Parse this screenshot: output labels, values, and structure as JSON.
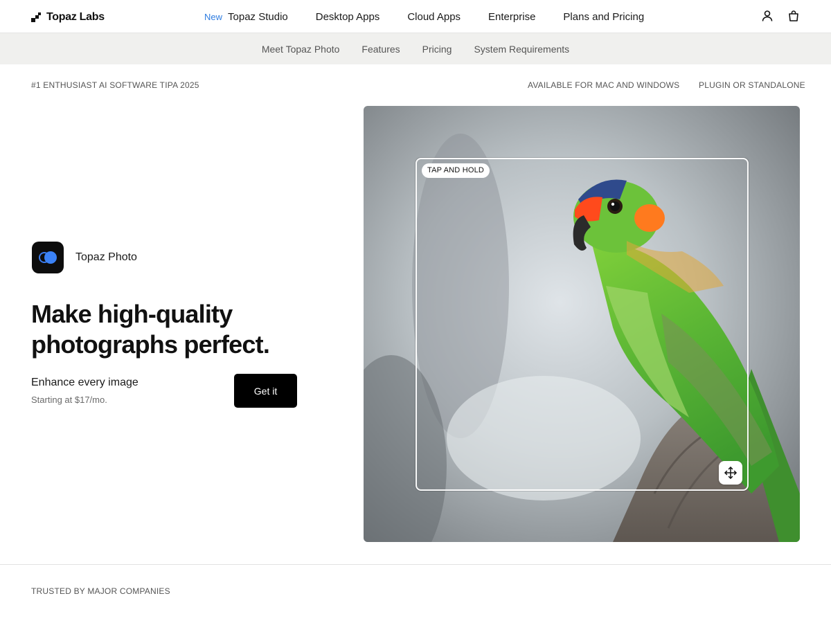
{
  "brand": {
    "name": "Topaz Labs",
    "icon": "topaz-logo-icon"
  },
  "nav": {
    "new_badge": "New",
    "links": [
      "Topaz Studio",
      "Desktop Apps",
      "Cloud Apps",
      "Enterprise",
      "Plans and Pricing"
    ],
    "icons": [
      "account-icon",
      "cart-icon"
    ]
  },
  "subnav": {
    "items": [
      "Meet Topaz Photo",
      "Features",
      "Pricing",
      "System Requirements"
    ]
  },
  "labels": {
    "award": "#1 ENTHUSIAST AI SOFTWARE TIPA 2025",
    "platform": "AVAILABLE FOR MAC AND WINDOWS",
    "mode": "PLUGIN OR STANDALONE"
  },
  "hero": {
    "app_name": "Topaz Photo",
    "app_icon": "topaz-photo-app-icon",
    "headline": "Make high-quality photographs perfect.",
    "subheadline": "Enhance every image",
    "price_note": "Starting at $17/mo.",
    "cta_label": "Get it",
    "image": {
      "subject": "parrot-photo",
      "badge": "TAP AND HOLD",
      "handle_icon": "move-icon"
    }
  },
  "trusted": {
    "label": "TRUSTED BY MAJOR COMPANIES"
  },
  "colors": {
    "accent_blue": "#3b82f6",
    "new_badge_blue": "#2f7de1",
    "cta_bg": "#000000",
    "subnav_bg": "#f0f0ee"
  }
}
